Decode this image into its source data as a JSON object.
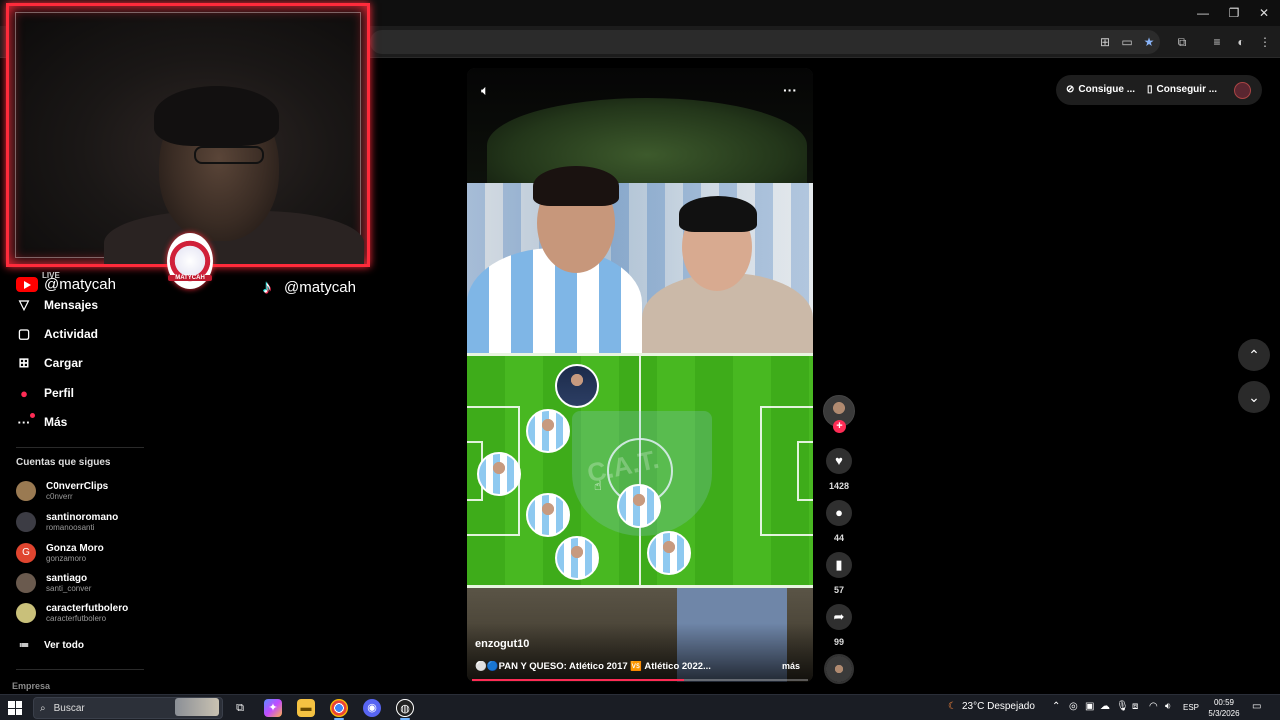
{
  "stream_overlay": {
    "youtube_handle": "@matycah",
    "tiktok_handle": "@matycah",
    "live_label": "LIVE",
    "badge_text": "MATYCAH"
  },
  "sidebar": {
    "nav": [
      {
        "label": "Mensajes",
        "icon": "send-icon"
      },
      {
        "label": "Actividad",
        "icon": "inbox-icon"
      },
      {
        "label": "Cargar",
        "icon": "upload-icon"
      },
      {
        "label": "Perfil",
        "icon": "profile-icon"
      },
      {
        "label": "Más",
        "icon": "more-icon"
      }
    ],
    "following_title": "Cuentas que sigues",
    "following": [
      {
        "name": "C0nverrClips",
        "user": "c0nverr"
      },
      {
        "name": "santinoromano",
        "user": "romanoosanti"
      },
      {
        "name": "Gonza Moro",
        "user": "gonzamoro",
        "initial": "G"
      },
      {
        "name": "santiago",
        "user": "santi_conver"
      },
      {
        "name": "caracterfutbolero",
        "user": "caracterfutbolero"
      }
    ],
    "see_all": "Ver todo",
    "footer": "Empresa"
  },
  "video": {
    "author": "enzogut10",
    "description": "⚪🔵PAN Y QUESO: Atlético 2017 🆚 Atlético 2022...",
    "more_label": "más",
    "progress": 0.63,
    "crest_text": "C.A.T."
  },
  "actions": {
    "likes": "1428",
    "comments": "44",
    "saves": "57",
    "shares": "99"
  },
  "top_buttons": {
    "coins_label": "Consigue ...",
    "app_label": "Conseguir ..."
  },
  "taskbar": {
    "search_placeholder": "Buscar",
    "weather": "23°C  Despejado",
    "language": "ESP",
    "time": "00:59",
    "date": "5/3/2026"
  },
  "colors": {
    "overlay_border": "#ff2b3b",
    "tiktok_accent": "#fe2c55",
    "pitch_green": "#48b821"
  }
}
